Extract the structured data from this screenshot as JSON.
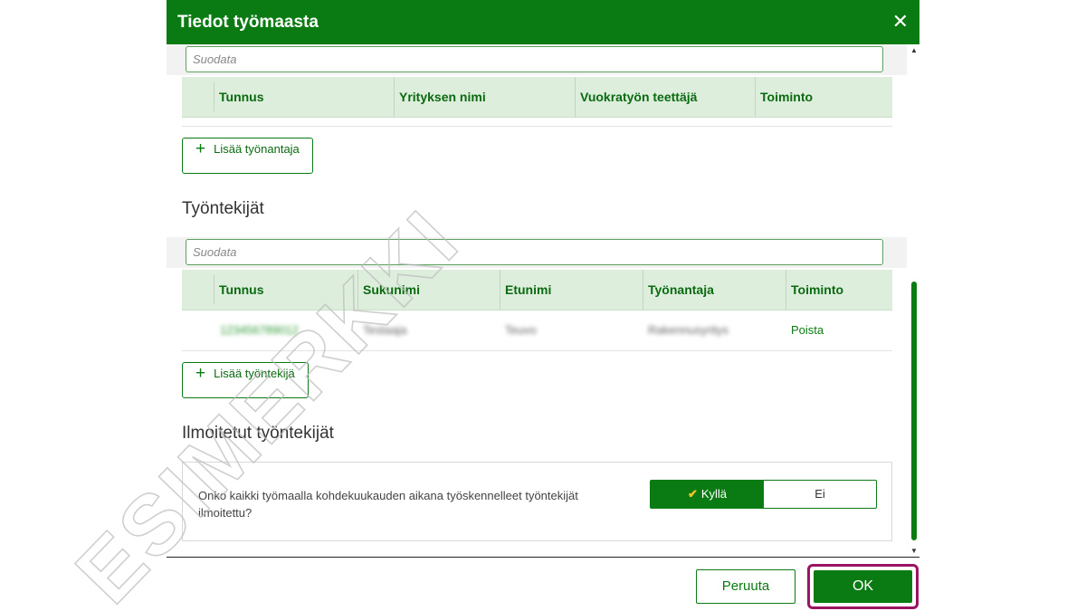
{
  "dialog": {
    "title": "Tiedot työmaasta",
    "close_icon": "close-icon",
    "accent_color": "#0a7a12"
  },
  "employers_table": {
    "filter_placeholder": "Suodata",
    "columns": [
      "Tunnus",
      "Yrityksen nimi",
      "Vuokratyön teettäjä",
      "Toiminto"
    ],
    "add_button": "Lisää työnantaja"
  },
  "employees_section": {
    "title": "Työntekijät",
    "filter_placeholder": "Suodata",
    "columns": [
      "Tunnus",
      "Sukunimi",
      "Etunimi",
      "Työnantaja",
      "Toiminto"
    ],
    "rows": [
      {
        "tunnus": "123456789012",
        "sukunimi": "Testaaja",
        "etunimi": "Teuvo",
        "tyonantaja": "Rakennusyritys",
        "toiminto": "Poista"
      }
    ],
    "add_button": "Lisää työntekijä"
  },
  "reported_section": {
    "title": "Ilmoitetut työntekijät",
    "question": "Onko kaikki työmaalla kohdekuukauden aikana työskennelleet työntekijät ilmoitettu?",
    "options": {
      "yes": "Kyllä",
      "no": "Ei"
    },
    "selected": "yes"
  },
  "footer": {
    "cancel": "Peruuta",
    "ok": "OK"
  },
  "watermark": {
    "text": "ESIMERKKI"
  }
}
